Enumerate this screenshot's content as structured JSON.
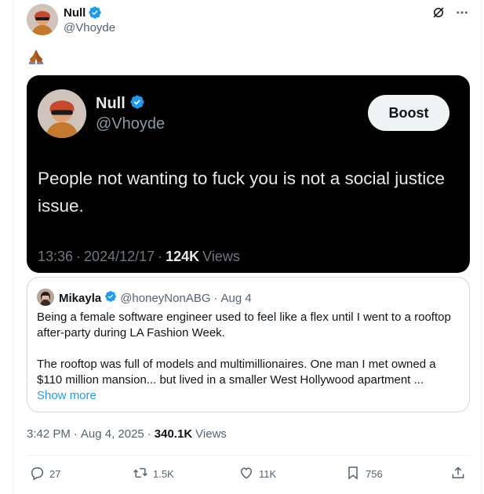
{
  "author": {
    "name": "Null",
    "handle": "@Vhoyde"
  },
  "post_text_icon": "folded-hands-emoji",
  "embedded": {
    "name": "Null",
    "handle": "@Vhoyde",
    "boost_label": "Boost",
    "text": "People not wanting to fuck you is not a social justice issue.",
    "time": "13:36",
    "sep1": "·",
    "date": "2024/12/17",
    "sep2": "·",
    "views_count": "124K",
    "views_label": "Views"
  },
  "quote": {
    "name": "Mikayla",
    "handle": "@honeyNonABG",
    "sep": "·",
    "date": "Aug 4",
    "paragraph1": "Being a female software engineer used to feel like a flex until I went to a rooftop after-party during LA Fashion Week.",
    "paragraph2": "The rooftop was full of models and multimillionaires. One man I met owned a $110 million mansion... but lived in a smaller West Hollywood apartment ...",
    "show_more": "Show more"
  },
  "meta": {
    "time": "3:42 PM",
    "sep1": "·",
    "date": "Aug 4, 2025",
    "sep2": "·",
    "views_count": "340.1K",
    "views_label": "Views"
  },
  "actions": {
    "replies": "27",
    "reposts": "1.5K",
    "likes": "11K",
    "bookmarks": "756"
  },
  "colors": {
    "accent": "#1d9bf0",
    "verified": "#1d9bf0",
    "muted": "#536471"
  }
}
